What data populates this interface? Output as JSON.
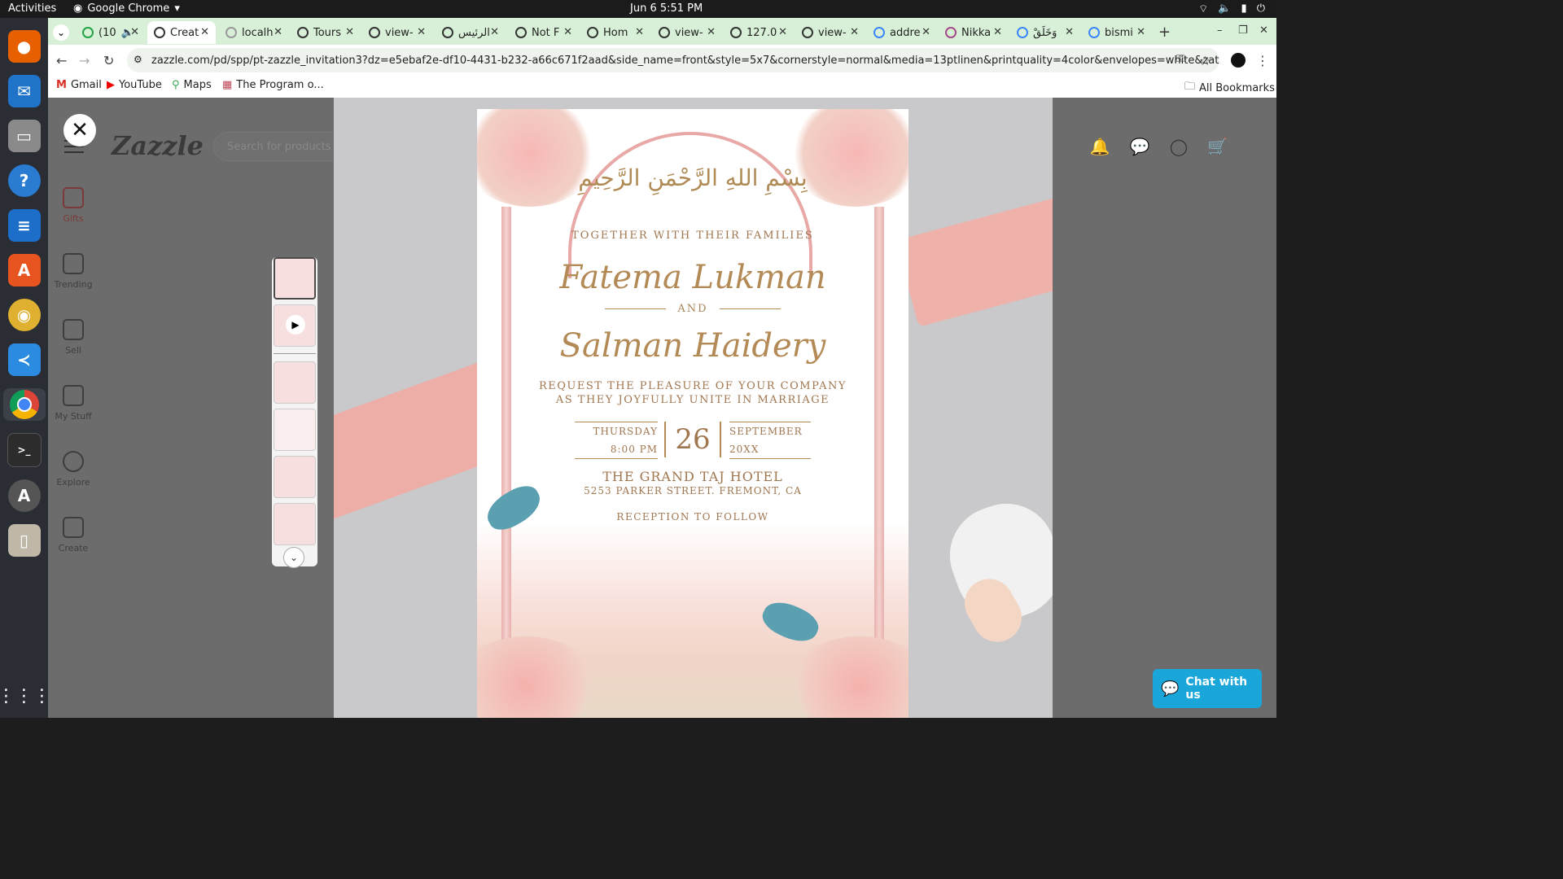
{
  "topbar": {
    "activities": "Activities",
    "app_name": "Google Chrome",
    "clock": "Jun 6  5:51 PM"
  },
  "dock": {
    "icons": [
      "firefox-icon",
      "thunderbird-icon",
      "files-icon",
      "help-icon",
      "writer-icon",
      "software-icon",
      "rhythmbox-icon",
      "vscode-icon",
      "chrome-icon",
      "terminal-icon",
      "updater-icon",
      "archive-icon"
    ]
  },
  "chrome": {
    "tabs": [
      {
        "label": "(10",
        "active": false
      },
      {
        "label": "Creat",
        "active": true
      },
      {
        "label": "localh",
        "active": false
      },
      {
        "label": "Tours",
        "active": false
      },
      {
        "label": "view-",
        "active": false
      },
      {
        "label": "الرئيس",
        "active": false
      },
      {
        "label": "Not F",
        "active": false
      },
      {
        "label": "Hom",
        "active": false
      },
      {
        "label": "view-",
        "active": false
      },
      {
        "label": "127.0",
        "active": false
      },
      {
        "label": "view-",
        "active": false
      },
      {
        "label": "addre",
        "active": false
      },
      {
        "label": "Nikka",
        "active": false
      },
      {
        "label": "وَخَلَقْ",
        "active": false
      },
      {
        "label": "bismi",
        "active": false
      }
    ],
    "url": "zazzle.com/pd/spp/pt-zazzle_invitation3?dz=e5ebaf2e-df10-4431-b232-a66c671f2aad&side_name=front&style=5x7&cornerstyle=normal&media=13ptlinen&printquality=4color&envelopes=white&zattribution=none&design.areas=%5B5x7_fr...",
    "bookmarks": [
      "Gmail",
      "YouTube",
      "Maps",
      "The Program o..."
    ],
    "all_bookmarks": "All Bookmarks"
  },
  "zazzle": {
    "logo": "Zazzle",
    "search_placeholder": "Search for products or",
    "sidebar": [
      "Gifts",
      "Trending",
      "Sell",
      "My Stuff",
      "Explore",
      "Create"
    ],
    "chat_label": "Chat with us"
  },
  "invitation": {
    "bismillah": "بِسْمِ اللهِ الرَّحْمَنِ الرَّحِيمِ",
    "together": "TOGETHER WITH THEIR FAMILIES",
    "name1": "Fatema Lukman",
    "and": "AND",
    "name2": "Salman Haidery",
    "request_line1": "REQUEST THE PLEASURE OF YOUR COMPANY",
    "request_line2": "AS THEY JOYFULLY UNITE IN MARRIAGE",
    "weekday": "THURSDAY",
    "time": "8:00 PM",
    "day": "26",
    "month": "SEPTEMBER",
    "year": "20XX",
    "venue": "THE GRAND TAJ HOTEL",
    "address": "5253 PARKER STREET. FREMONT, CA",
    "reception": "RECEPTION TO FOLLOW"
  }
}
